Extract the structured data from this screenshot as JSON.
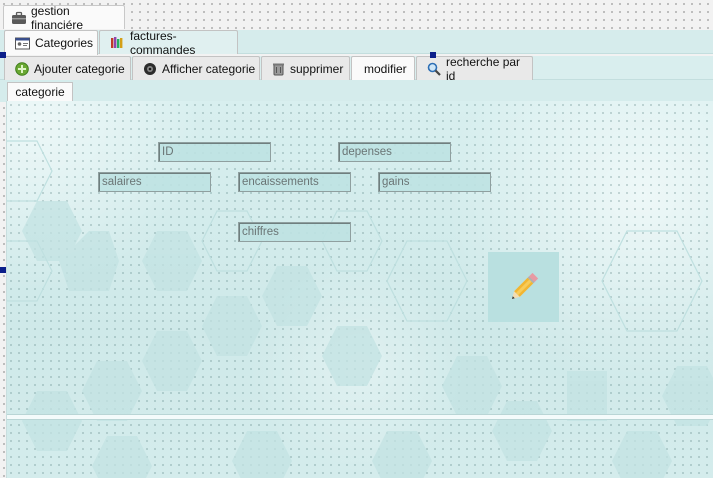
{
  "window": {
    "title": "gestion financiére"
  },
  "main_tabs": [
    {
      "label": "Categories",
      "icon": "id-card-icon",
      "active": true
    },
    {
      "label": "factures-commandes",
      "icon": "books-icon",
      "active": false
    }
  ],
  "action_tabs": [
    {
      "label": "Ajouter categorie",
      "icon": "add-icon"
    },
    {
      "label": "Afficher categorie",
      "icon": "eye-icon"
    },
    {
      "label": "supprimer",
      "icon": "trash-icon"
    },
    {
      "label": "modifier",
      "icon": "",
      "active": true
    },
    {
      "label": "recherche par id",
      "icon": "search-icon"
    }
  ],
  "sub_tabs": [
    {
      "label": "categorie",
      "active": true
    }
  ],
  "form": {
    "id": {
      "placeholder": "ID",
      "value": ""
    },
    "depenses": {
      "placeholder": "depenses",
      "value": ""
    },
    "salaires": {
      "placeholder": "salaires",
      "value": ""
    },
    "encaissements": {
      "placeholder": "encaissements",
      "value": ""
    },
    "gains": {
      "placeholder": "gains",
      "value": ""
    },
    "chiffres": {
      "placeholder": "chiffres",
      "value": ""
    }
  },
  "action_button": {
    "icon": "pencil-icon"
  },
  "colors": {
    "panel": "#daf0f0",
    "field": "#bee2e2",
    "handle": "#0b1f8a"
  }
}
